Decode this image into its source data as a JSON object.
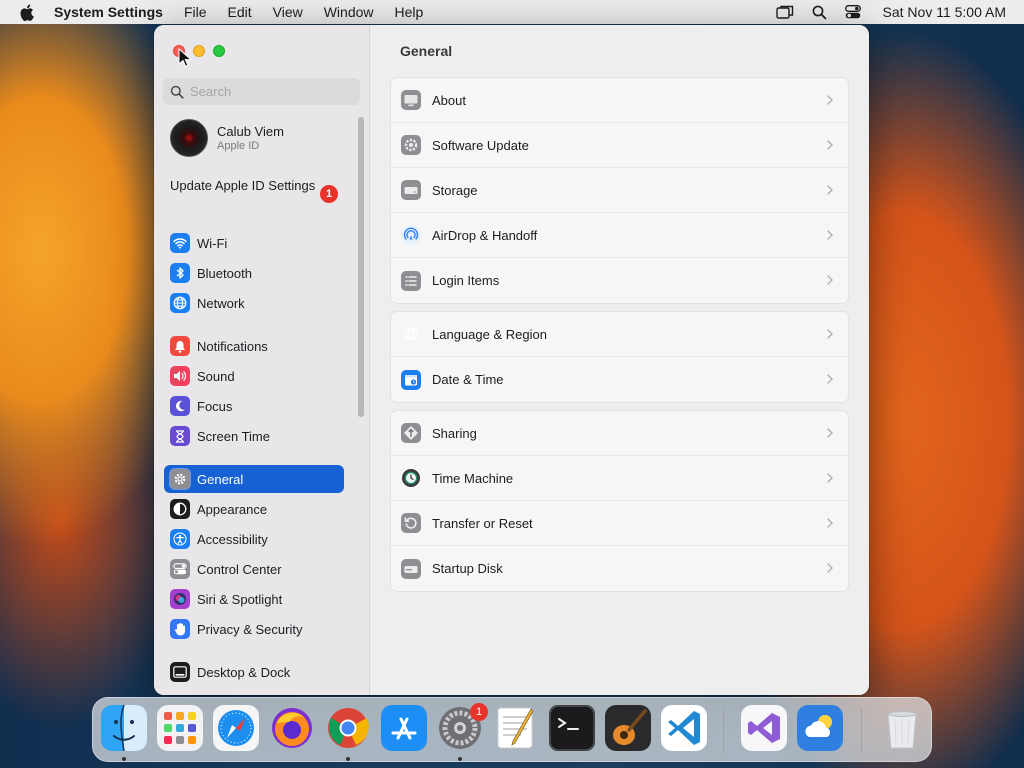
{
  "menubar": {
    "app_name": "System Settings",
    "items": [
      "File",
      "Edit",
      "View",
      "Window",
      "Help"
    ],
    "clock": "Sat Nov 11  5:00 AM"
  },
  "window": {
    "search_placeholder": "Search",
    "account": {
      "name": "Calub Viem",
      "subtitle": "Apple ID"
    },
    "update": {
      "label": "Update Apple ID Settings",
      "badge": "1"
    },
    "sidebar": [
      {
        "label": "Wi-Fi",
        "icon": "wifi-icon",
        "color": "#1b7ff2"
      },
      {
        "label": "Bluetooth",
        "icon": "bluetooth-icon",
        "color": "#1b7ff2"
      },
      {
        "label": "Network",
        "icon": "globe-icon",
        "color": "#1b7ff2"
      },
      {
        "label": "Notifications",
        "icon": "bell-icon",
        "color": "#f04a3f"
      },
      {
        "label": "Sound",
        "icon": "speaker-icon",
        "color": "#f0415e"
      },
      {
        "label": "Focus",
        "icon": "moon-icon",
        "color": "#5a51d6"
      },
      {
        "label": "Screen Time",
        "icon": "hourglass-icon",
        "color": "#6a4ad0"
      },
      {
        "label": "General",
        "icon": "gear-icon",
        "color": "#8e8e93",
        "active": true
      },
      {
        "label": "Appearance",
        "icon": "appearance-icon",
        "color": "#1d1d1f"
      },
      {
        "label": "Accessibility",
        "icon": "accessibility-icon",
        "color": "#1b7ff2"
      },
      {
        "label": "Control Center",
        "icon": "switches-icon",
        "color": "#8e8e93"
      },
      {
        "label": "Siri & Spotlight",
        "icon": "siri-icon",
        "color": "#a340d0"
      },
      {
        "label": "Privacy & Security",
        "icon": "hand-icon",
        "color": "#3478f6"
      },
      {
        "label": "Desktop & Dock",
        "icon": "dock-icon",
        "color": "#1d1d1f"
      }
    ],
    "content_title": "General",
    "groups": [
      [
        {
          "label": "About",
          "icon": "display-icon"
        },
        {
          "label": "Software Update",
          "icon": "gear-badge-icon"
        },
        {
          "label": "Storage",
          "icon": "drive-icon"
        },
        {
          "label": "AirDrop & Handoff",
          "icon": "airdrop-icon"
        },
        {
          "label": "Login Items",
          "icon": "list-icon"
        }
      ],
      [
        {
          "label": "Language & Region",
          "icon": "globe-icon"
        },
        {
          "label": "Date & Time",
          "icon": "calendar-icon"
        }
      ],
      [
        {
          "label": "Sharing",
          "icon": "sharing-icon"
        },
        {
          "label": "Time Machine",
          "icon": "time-machine-icon"
        },
        {
          "label": "Transfer or Reset",
          "icon": "reset-icon"
        },
        {
          "label": "Startup Disk",
          "icon": "disk-icon"
        }
      ]
    ]
  },
  "dock": {
    "apps": [
      {
        "name": "finder-icon",
        "running": true
      },
      {
        "name": "launchpad-icon",
        "running": false
      },
      {
        "name": "safari-icon",
        "running": false
      },
      {
        "name": "firefox-icon",
        "running": false
      },
      {
        "name": "chrome-icon",
        "running": true
      },
      {
        "name": "app-store-icon",
        "running": false
      },
      {
        "name": "system-settings-icon",
        "running": true,
        "badge": "1"
      },
      {
        "name": "textedit-icon",
        "running": false
      },
      {
        "name": "terminal-icon",
        "running": false
      },
      {
        "name": "garageband-icon",
        "running": false
      },
      {
        "name": "vscode-icon",
        "running": false
      },
      {
        "name": "visual-studio-icon",
        "running": false
      },
      {
        "name": "weather-icon",
        "running": false
      },
      {
        "name": "trash-icon",
        "running": false
      }
    ]
  }
}
